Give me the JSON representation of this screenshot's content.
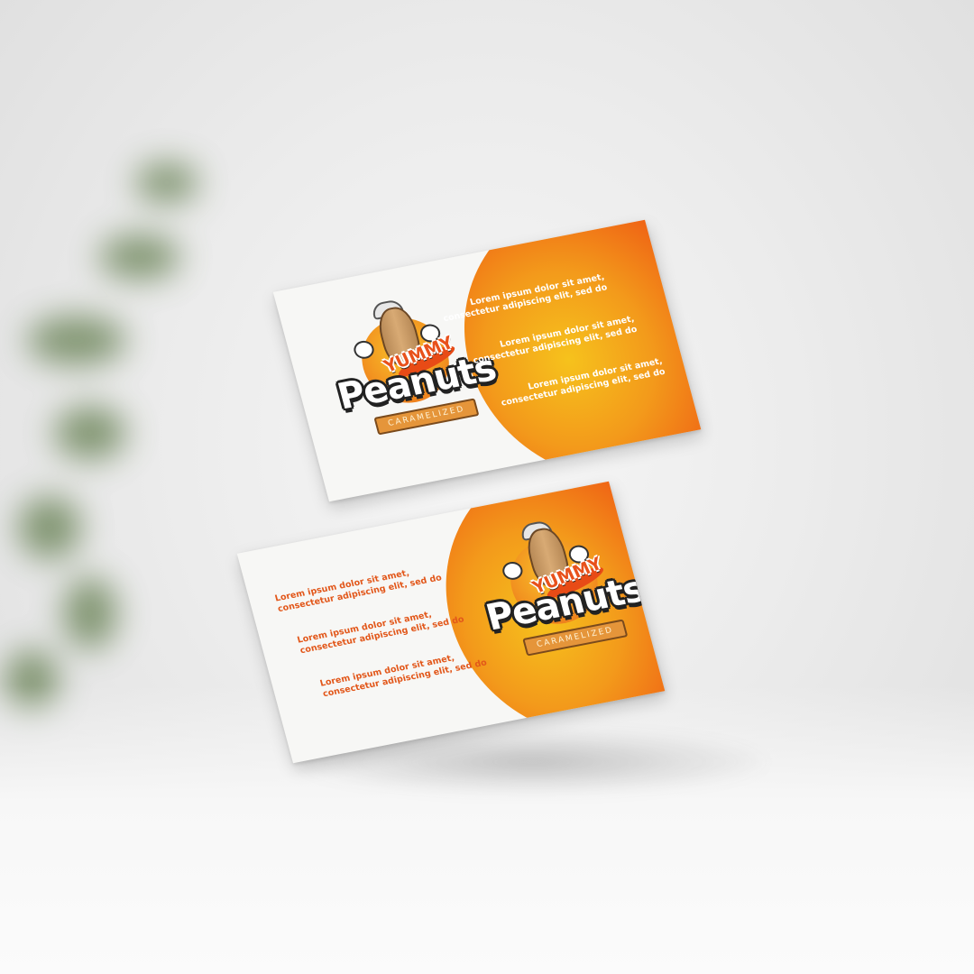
{
  "scene": {
    "description_colors": {
      "orange_light": "#f6c21c",
      "orange_mid": "#f39a1b",
      "orange_dark": "#e8430f",
      "text_orange": "#e2571a",
      "card_white": "#f7f7f5"
    }
  },
  "logo": {
    "top_word": "YUMMY",
    "main_word": "Peanuts",
    "ribbon_text": "CARAMELIZED"
  },
  "front_card": {
    "copy": [
      {
        "line1": "Lorem ipsum dolor sit amet,",
        "line2": "consectetur adipiscing elit, sed do"
      },
      {
        "line1": "Lorem ipsum dolor sit amet,",
        "line2": "consectetur adipiscing elit, sed do"
      },
      {
        "line1": "Lorem ipsum dolor sit amet,",
        "line2": "consectetur adipiscing elit, sed do"
      }
    ]
  },
  "back_card": {
    "copy": [
      {
        "line1": "Lorem ipsum dolor sit amet,",
        "line2": "consectetur adipiscing elit, sed do"
      },
      {
        "line1": "Lorem ipsum dolor sit amet,",
        "line2": "consectetur adipiscing elit, sed do"
      },
      {
        "line1": "Lorem ipsum dolor sit amet,",
        "line2": "consectetur adipiscing elit, sed do"
      }
    ]
  }
}
